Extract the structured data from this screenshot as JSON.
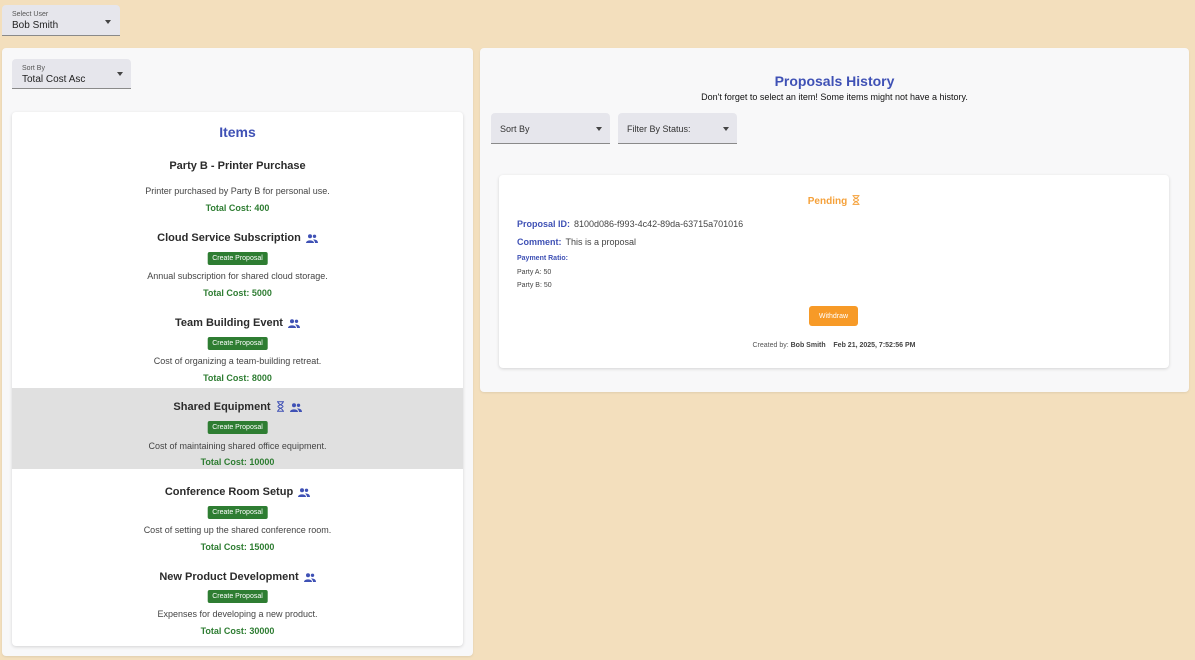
{
  "user_select": {
    "label": "Select User",
    "value": "Bob Smith"
  },
  "sort_select": {
    "label": "Sort By",
    "value": "Total Cost Asc"
  },
  "items": {
    "title": "Items",
    "create_label": "Create Proposal",
    "list": [
      {
        "name": "Party B - Printer Purchase",
        "desc": "Printer purchased by Party B for personal use.",
        "cost": "Total Cost: 400"
      },
      {
        "name": "Cloud Service Subscription",
        "desc": "Annual subscription for shared cloud storage.",
        "cost": "Total Cost: 5000"
      },
      {
        "name": "Team Building Event",
        "desc": "Cost of organizing a team-building retreat.",
        "cost": "Total Cost: 8000"
      },
      {
        "name": "Shared Equipment",
        "desc": "Cost of maintaining shared office equipment.",
        "cost": "Total Cost: 10000"
      },
      {
        "name": "Conference Room Setup",
        "desc": "Cost of setting up the shared conference room.",
        "cost": "Total Cost: 15000"
      },
      {
        "name": "New Product Development",
        "desc": "Expenses for developing a new product.",
        "cost": "Total Cost: 30000"
      }
    ]
  },
  "history": {
    "title": "Proposals History",
    "subtitle": "Don't forget to select an item! Some items might not have a history.",
    "sort_placeholder": "Sort By",
    "filter_placeholder": "Filter By Status:"
  },
  "proposal": {
    "status": "Pending",
    "id_label": "Proposal ID:",
    "id": "8100d086-f993-4c42-89da-63715a701016",
    "comment_label": "Comment:",
    "comment": "This is a proposal",
    "ratio_label": "Payment Ratio:",
    "party_a": "Party A: 50",
    "party_b": "Party B: 50",
    "withdraw_label": "Withdraw",
    "created_by_label": "Created by:",
    "created_by": "Bob Smith",
    "created_at": "Feb 21, 2025, 7:52:56 PM"
  },
  "colors": {
    "accent": "#3f51b5",
    "success": "#2e7d32",
    "warning": "#f79a27",
    "background": "#f3dfbd"
  }
}
